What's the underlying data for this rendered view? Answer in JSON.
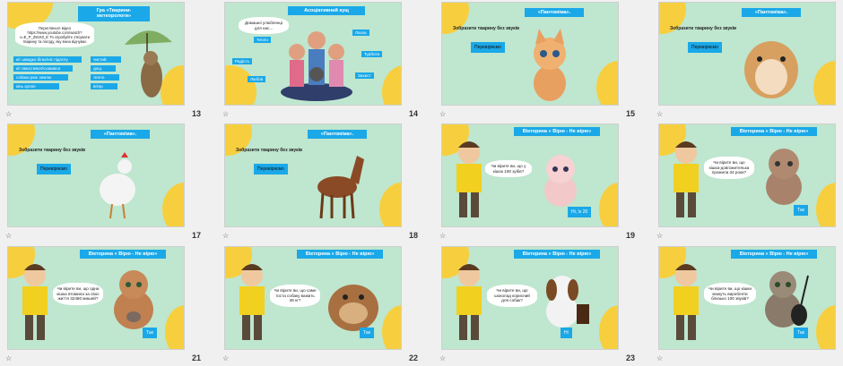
{
  "slides": [
    {
      "num": "13",
      "title": "Гра «Тварини-метеорологи»",
      "text": "Перегляньте відео https://www.youtube.com/watch?v=E_P_Z9cK0_E То спробуйте з'ясувати тварину та погоду, яку вона відчуває",
      "left_tags": [
        "кіт швидко бігає/ніс підлогу",
        "кіт вмостився/сховався",
        "собака рює землю",
        "кінь хропе"
      ],
      "right_tags": [
        "чистий",
        "дощ",
        "тепло",
        "вітер"
      ]
    },
    {
      "num": "14",
      "title": "Асоціативний кущ",
      "bubble": "Домашні улюбленці для нас...",
      "words": [
        "Тепло",
        "Ласка",
        "Радість",
        "Турбота",
        "Любов",
        "Захист"
      ]
    },
    {
      "num": "15",
      "title": "«Пантоміма».",
      "prompt": "Зобразити тварину без звуків",
      "button": "Перевіряємо"
    },
    {
      "num": "16",
      "title": "«Пантоміма».",
      "prompt": "Зобразити тварину без звуків",
      "button": "Перевіряємо"
    },
    {
      "num": "17",
      "title": "«Пантоміма».",
      "prompt": "Зобразити тварину без звуків",
      "button": "Перевіряємо"
    },
    {
      "num": "18",
      "title": "«Пантоміма».",
      "prompt": "Зобразити тварину без звуків",
      "button": "Перевіряємо"
    },
    {
      "num": "19",
      "title": "Вікторина « Вірю - Не вірю»",
      "question": "Чи вірите ви, що у кішок 100 зубів?",
      "answer": "Ні, їх 20"
    },
    {
      "num": "20",
      "title": "Вікторина « Вірю - Не вірю»",
      "question": "Чи вірите ви, що кішка-довгожителька прожила 34 роки?",
      "answer": "Так"
    },
    {
      "num": "21",
      "title": "Вікторина « Вірю - Не вірю»",
      "question": "Чи вірите ви, що одна кішка втомила за своє життя 32480 мишей?",
      "answer": "Так"
    },
    {
      "num": "22",
      "title": "Вікторина « Вірю - Не вірю»",
      "question": "Чи вірите ви, що саме тоста собаку важить 38 кг?",
      "answer": "Так"
    },
    {
      "num": "23",
      "title": "Вікторина « Вірю - Не вірю»",
      "question": "Чи вірите ви, що шоколад корисний для собак?",
      "answer": "Ні"
    },
    {
      "num": "24",
      "title": "Вікторина « Вірю - Не вірю»",
      "question": "Чи вірите ви, що кішки можуть виробляти близько 100 звуків?",
      "answer": "Так"
    }
  ],
  "star_glyph": "☆",
  "colors": {
    "accent": "#1aa8e8",
    "bg": "#bfe6cf",
    "yellow": "#f7cf3e"
  }
}
